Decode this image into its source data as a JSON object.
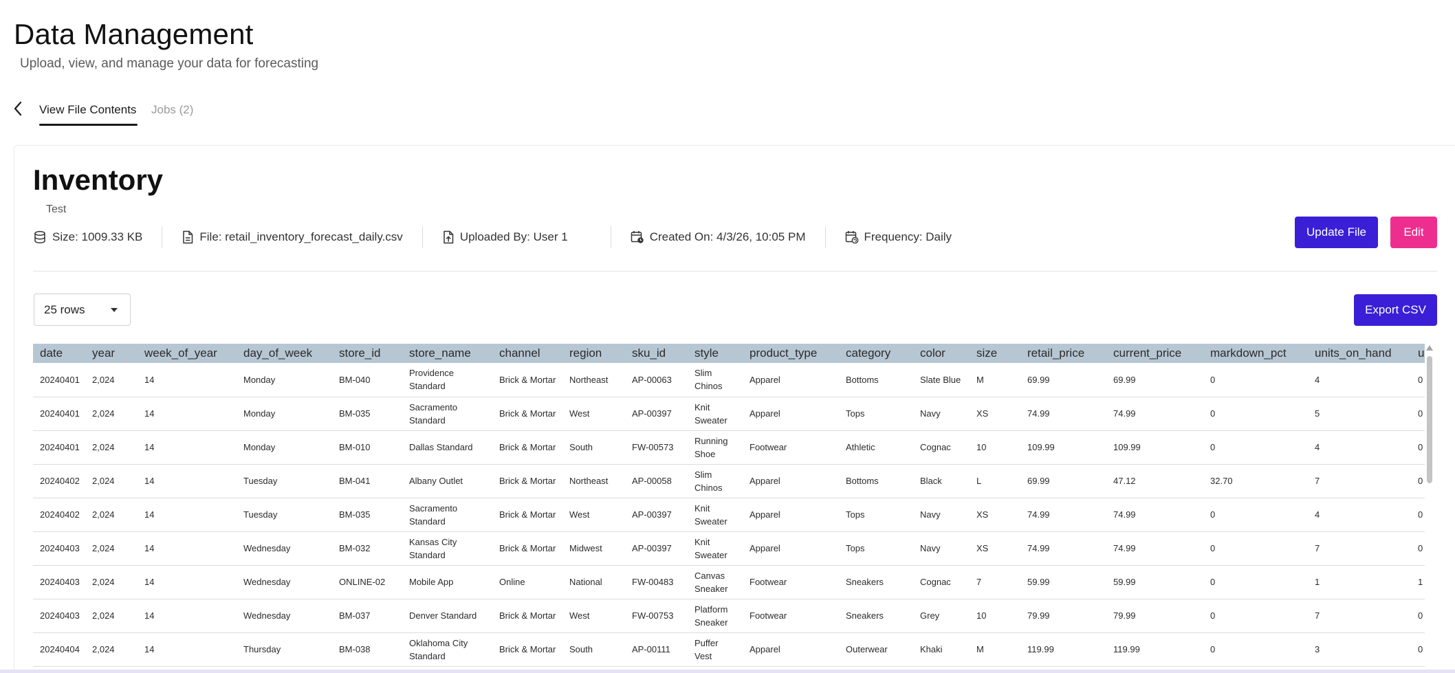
{
  "header": {
    "title": "Data Management",
    "subtitle": "Upload, view, and manage your data for forecasting"
  },
  "tabs": [
    {
      "label": "View File Contents",
      "active": true
    },
    {
      "label": "Jobs (2)",
      "active": false
    }
  ],
  "file": {
    "title": "Inventory",
    "description": "Test",
    "meta": {
      "size": "Size: 1009.33 KB",
      "file": "File: retail_inventory_forecast_daily.csv",
      "uploaded_by": "Uploaded By: User 1",
      "created_on": "Created On: 4/3/26, 10:05 PM",
      "frequency": "Frequency: Daily"
    }
  },
  "actions": {
    "update_label": "Update File",
    "edit_label": "Edit",
    "export_label": "Export CSV"
  },
  "rows_select": {
    "value": "25 rows"
  },
  "colors": {
    "primary": "#3b1fd6",
    "edit": "#ee2e8e",
    "table_header": "#b7c6d3"
  },
  "table": {
    "columns": [
      "date",
      "year",
      "week_of_year",
      "day_of_week",
      "store_id",
      "store_name",
      "channel",
      "region",
      "sku_id",
      "style",
      "product_type",
      "category",
      "color",
      "size",
      "retail_price",
      "current_price",
      "markdown_pct",
      "units_on_hand",
      "u"
    ],
    "rows": [
      [
        "20240401",
        "2,024",
        "14",
        "Monday",
        "BM-040",
        "Providence Standard",
        "Brick & Mortar",
        "Northeast",
        "AP-00063",
        "Slim Chinos",
        "Apparel",
        "Bottoms",
        "Slate Blue",
        "M",
        "69.99",
        "69.99",
        "0",
        "4",
        "0"
      ],
      [
        "20240401",
        "2,024",
        "14",
        "Monday",
        "BM-035",
        "Sacramento Standard",
        "Brick & Mortar",
        "West",
        "AP-00397",
        "Knit Sweater",
        "Apparel",
        "Tops",
        "Navy",
        "XS",
        "74.99",
        "74.99",
        "0",
        "5",
        "0"
      ],
      [
        "20240401",
        "2,024",
        "14",
        "Monday",
        "BM-010",
        "Dallas Standard",
        "Brick & Mortar",
        "South",
        "FW-00573",
        "Running Shoe",
        "Footwear",
        "Athletic",
        "Cognac",
        "10",
        "109.99",
        "109.99",
        "0",
        "4",
        "0"
      ],
      [
        "20240402",
        "2,024",
        "14",
        "Tuesday",
        "BM-041",
        "Albany Outlet",
        "Brick & Mortar",
        "Northeast",
        "AP-00058",
        "Slim Chinos",
        "Apparel",
        "Bottoms",
        "Black",
        "L",
        "69.99",
        "47.12",
        "32.70",
        "7",
        "0"
      ],
      [
        "20240402",
        "2,024",
        "14",
        "Tuesday",
        "BM-035",
        "Sacramento Standard",
        "Brick & Mortar",
        "West",
        "AP-00397",
        "Knit Sweater",
        "Apparel",
        "Tops",
        "Navy",
        "XS",
        "74.99",
        "74.99",
        "0",
        "4",
        "0"
      ],
      [
        "20240403",
        "2,024",
        "14",
        "Wednesday",
        "BM-032",
        "Kansas City Standard",
        "Brick & Mortar",
        "Midwest",
        "AP-00397",
        "Knit Sweater",
        "Apparel",
        "Tops",
        "Navy",
        "XS",
        "74.99",
        "74.99",
        "0",
        "7",
        "0"
      ],
      [
        "20240403",
        "2,024",
        "14",
        "Wednesday",
        "ONLINE-02",
        "Mobile App",
        "Online",
        "National",
        "FW-00483",
        "Canvas Sneaker",
        "Footwear",
        "Sneakers",
        "Cognac",
        "7",
        "59.99",
        "59.99",
        "0",
        "1",
        "1"
      ],
      [
        "20240403",
        "2,024",
        "14",
        "Wednesday",
        "BM-037",
        "Denver Standard",
        "Brick & Mortar",
        "West",
        "FW-00753",
        "Platform Sneaker",
        "Footwear",
        "Sneakers",
        "Grey",
        "10",
        "79.99",
        "79.99",
        "0",
        "7",
        "0"
      ],
      [
        "20240404",
        "2,024",
        "14",
        "Thursday",
        "BM-038",
        "Oklahoma City Standard",
        "Brick & Mortar",
        "South",
        "AP-00111",
        "Puffer Vest",
        "Apparel",
        "Outerwear",
        "Khaki",
        "M",
        "119.99",
        "119.99",
        "0",
        "3",
        "0"
      ]
    ]
  }
}
